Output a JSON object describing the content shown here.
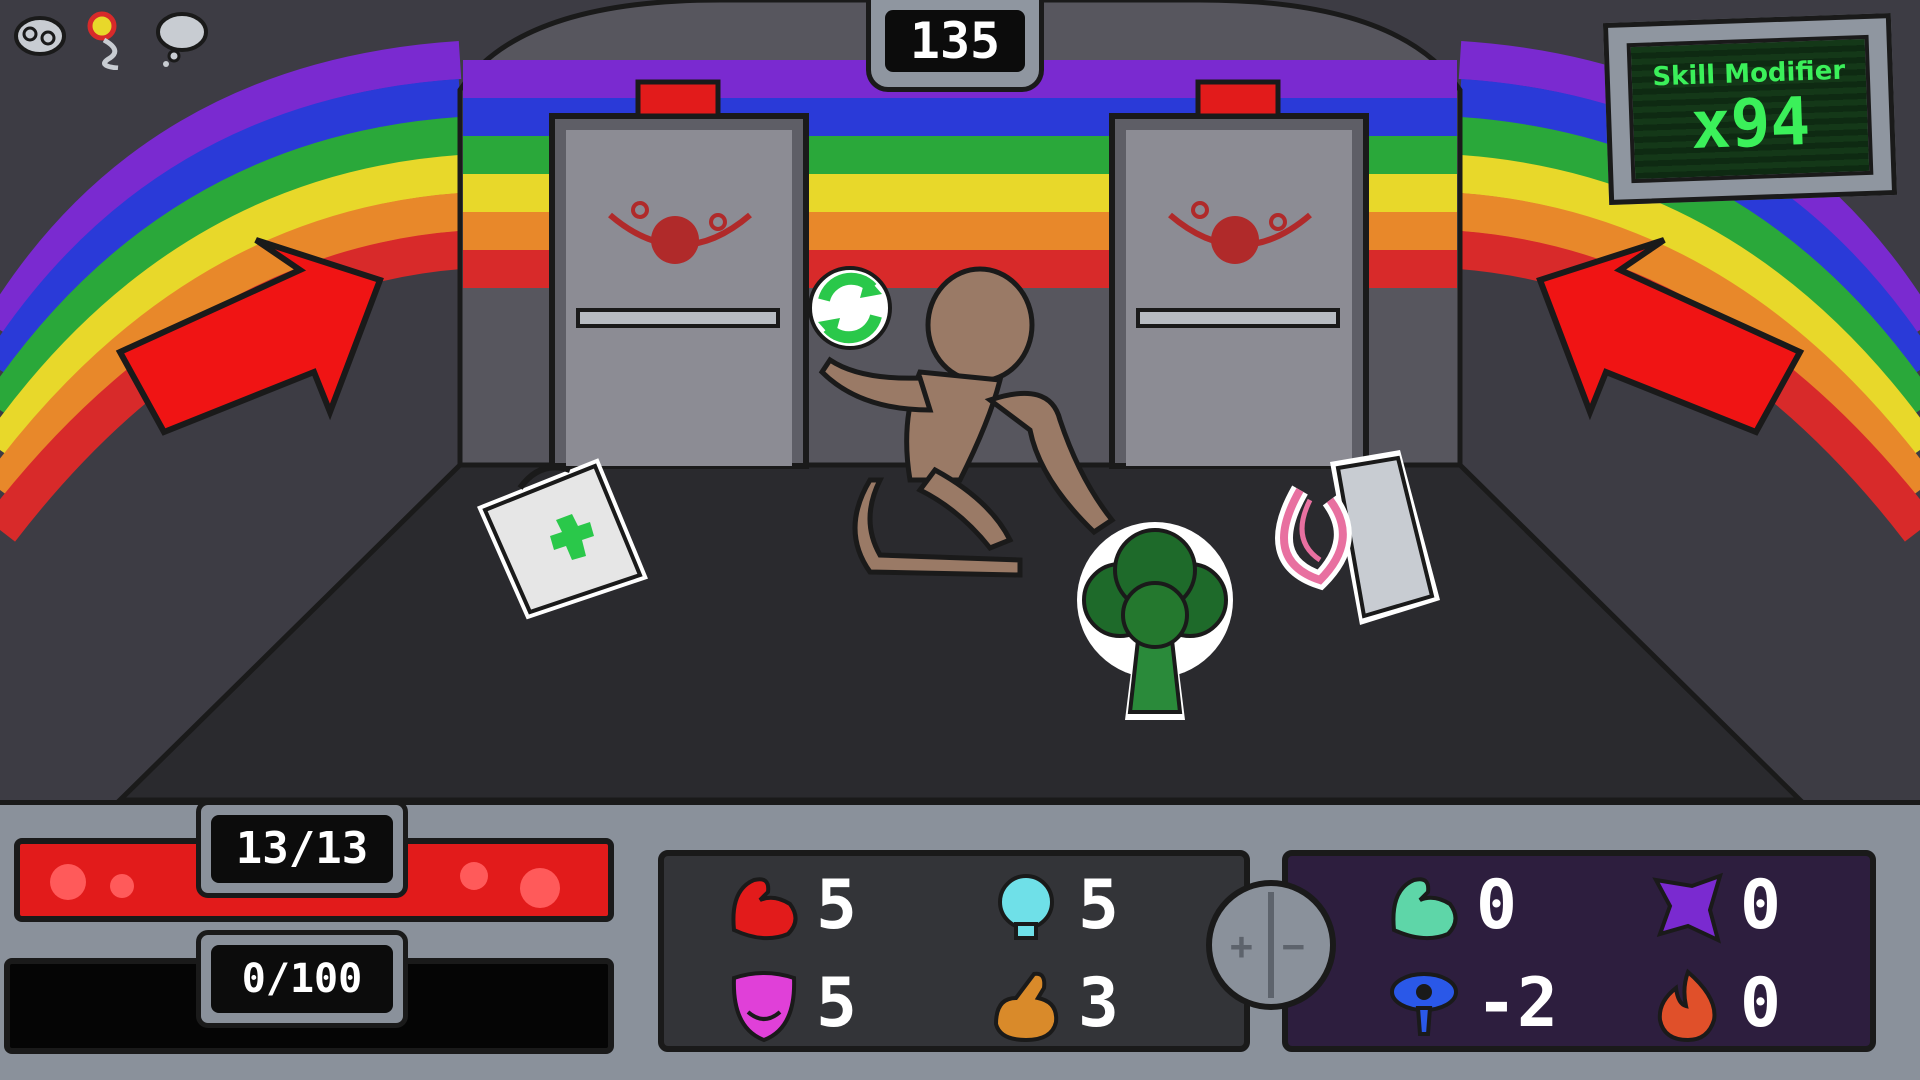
{
  "counter": {
    "value": "135"
  },
  "skill_modifier": {
    "title": "Skill Modifier",
    "value": "x94"
  },
  "top_icons": [
    "brain-icon",
    "flower-icon",
    "thought-bubble-icon"
  ],
  "hp": {
    "label": "13/13",
    "fill_fraction": 1.0,
    "color": "#e21b1b"
  },
  "xp": {
    "label": "0/100",
    "fill_fraction": 0.0
  },
  "items": [
    "first-aid-kit",
    "broccoli",
    "spray-bottle"
  ],
  "stats_primary": [
    {
      "icon": "muscle-icon",
      "value": "5",
      "color": "#e21b1b"
    },
    {
      "icon": "lightbulb-icon",
      "value": "5",
      "color": "#6fe0e8"
    },
    {
      "icon": "mask-icon",
      "value": "5",
      "color": "#e040d8"
    },
    {
      "icon": "fist-icon",
      "value": "3",
      "color": "#d98a2a"
    }
  ],
  "stats_secondary": [
    {
      "icon": "slime-muscle-icon",
      "value": "0",
      "color": "#5ed6a8"
    },
    {
      "icon": "purple-shape-icon",
      "value": "0",
      "color": "#7a2ad0"
    },
    {
      "icon": "eye-drip-icon",
      "value": "-2",
      "color": "#2a58e8"
    },
    {
      "icon": "fire-icon",
      "value": "0",
      "color": "#e0502a"
    }
  ],
  "toggle": {
    "plus": "+",
    "minus": "−"
  }
}
